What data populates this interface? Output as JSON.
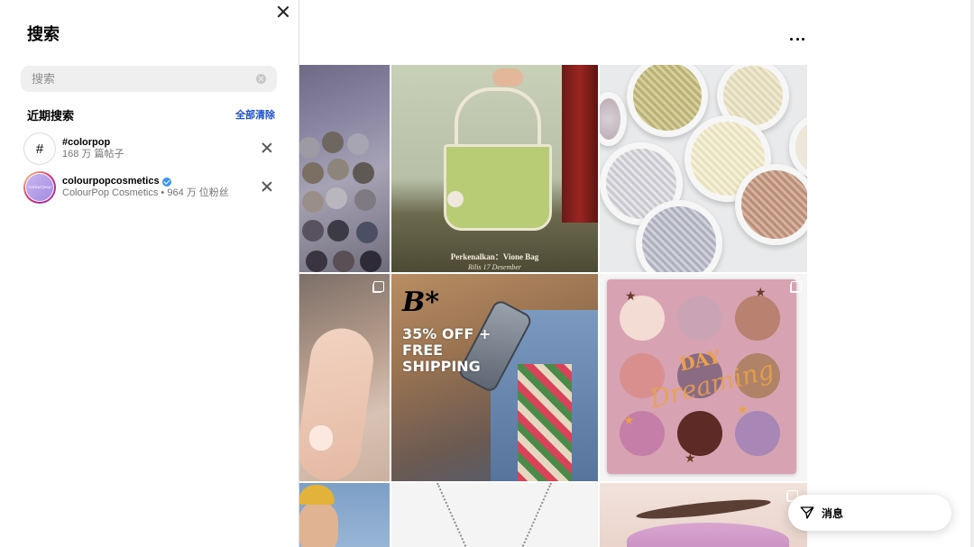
{
  "panel": {
    "title": "搜索",
    "search_placeholder": "搜索",
    "recent_heading": "近期搜索",
    "clear_all_label": "全部清除",
    "results": [
      {
        "type": "hashtag",
        "icon": "#",
        "name": "#colorpop",
        "subtitle": "168 万 篇帖子"
      },
      {
        "type": "account",
        "avatar_text": "colourpop",
        "name": "colourpopcosmetics",
        "verified": true,
        "subtitle": "ColourPop Cosmetics • 964 万 位粉丝"
      }
    ]
  },
  "grid": {
    "tile2_caption_line1": "Perkenalkan：Vione Bag",
    "tile2_caption_line2": "Rilis 17 Desember",
    "tile5_logo": "B*",
    "tile5_promo": "35% OFF + FREE SHIPPING",
    "tile6_word1": "DAY",
    "tile6_word2": "Dreaming"
  },
  "messages": {
    "label": "消息"
  },
  "icons": {
    "close": "close-icon",
    "more": "more-horizontal-icon",
    "clear": "clear-search-icon",
    "remove": "remove-icon",
    "multi": "multi-post-icon",
    "send": "paper-plane-icon",
    "verified": "verified-badge-icon"
  },
  "colors": {
    "link": "#1d4fd6",
    "verified": "#3797f0"
  }
}
